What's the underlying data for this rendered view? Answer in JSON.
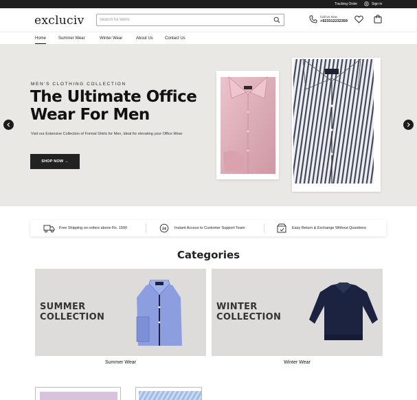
{
  "topbar": {
    "tracking_label": "Tracking Order",
    "signin_label": "Sign in",
    "icons": [
      "user-icon"
    ]
  },
  "header": {
    "logo_text": "excluciv",
    "search": {
      "placeholder": "Search for items",
      "value": ""
    },
    "call_label": "Call Us Now",
    "phone": "+923312232359",
    "icons": [
      "search-icon",
      "phone-icon",
      "heart-icon",
      "bag-icon"
    ]
  },
  "nav": {
    "items": [
      "Home",
      "Summer Wear",
      "Winter Wear",
      "About Us",
      "Contact Us"
    ],
    "active": "Home"
  },
  "hero": {
    "kicker": "MEN'S CLOTHING COLLECTION",
    "title": "The Ultimate Office Wear For Men",
    "description": "Visit our Extensive Collection of Formal Shirts for Men, Ideal for elevating your Office Wear",
    "cta_label": "SHOP NOW",
    "cta_arrow": "→",
    "images": [
      {
        "alt": "Pink formal shirt folded",
        "shirt_color": "#e6b8c0"
      },
      {
        "alt": "Striped formal shirt folded",
        "shirt_color": "#4a5060"
      }
    ],
    "carousel_icons": [
      "chevron-left-icon",
      "chevron-right-icon"
    ]
  },
  "features": [
    {
      "icon": "truck-icon",
      "text": "Free Shipping on orders above Rs. 1500"
    },
    {
      "icon": "support-24-icon",
      "text": "Instant Access to Customer Support Team"
    },
    {
      "icon": "return-box-icon",
      "text": "Easy Return & Exchange Without Questions"
    }
  ],
  "categories": {
    "title": "Categories",
    "items": [
      {
        "overlay_line1": "SUMMER",
        "overlay_line2": "COLLECTION",
        "label": "Summer Wear",
        "shirt_color": "#8f9fe0"
      },
      {
        "overlay_line1": "WINTER",
        "overlay_line2": "COLLECTION",
        "label": "Winter Wear",
        "shirt_color": "#1c2340"
      }
    ]
  },
  "colors": {
    "topbar": "#1f1f1f",
    "hero_bg": "#e9e8e5",
    "cta": "#222222",
    "category_bg": "#dddcda"
  }
}
